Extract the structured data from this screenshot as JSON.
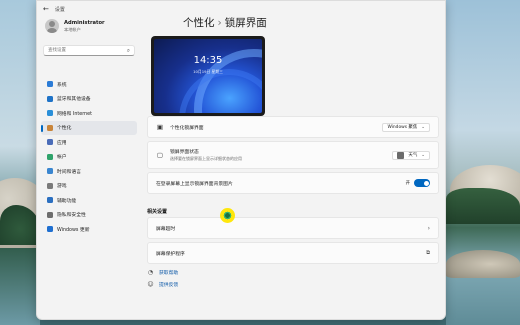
{
  "window": {
    "title": "设置",
    "back_icon": "back-arrow-icon"
  },
  "user": {
    "name": "Administrator",
    "type": "本地帐户"
  },
  "search": {
    "placeholder": "查找设置"
  },
  "nav": [
    {
      "label": "系统",
      "icon": "system-icon",
      "color": "#2b7bd6"
    },
    {
      "label": "蓝牙和其他设备",
      "icon": "bluetooth-icon",
      "color": "#1f73c7"
    },
    {
      "label": "网络和 Internet",
      "icon": "network-icon",
      "color": "#2a8fd8"
    },
    {
      "label": "个性化",
      "icon": "personalization-icon",
      "color": "#c9853a",
      "active": true
    },
    {
      "label": "应用",
      "icon": "apps-icon",
      "color": "#4a6cb8"
    },
    {
      "label": "帐户",
      "icon": "accounts-icon",
      "color": "#2fa36b"
    },
    {
      "label": "时间和语言",
      "icon": "time-language-icon",
      "color": "#3a86d0"
    },
    {
      "label": "游戏",
      "icon": "gaming-icon",
      "color": "#7a7a7a"
    },
    {
      "label": "辅助功能",
      "icon": "accessibility-icon",
      "color": "#2b6fc0"
    },
    {
      "label": "隐私和安全性",
      "icon": "privacy-icon",
      "color": "#6d6d6d"
    },
    {
      "label": "Windows 更新",
      "icon": "windows-update-icon",
      "color": "#1f6fd0"
    }
  ],
  "page": {
    "breadcrumb_parent": "个性化",
    "breadcrumb_sep": "›",
    "breadcrumb_current": "锁屏界面"
  },
  "preview": {
    "time": "14:35",
    "date": "10月19日 星期三"
  },
  "settings": {
    "personalize_label": "个性化锁屏界面",
    "personalize_value": "Windows 聚焦",
    "status_label": "锁屏界面状态",
    "status_sub": "选择要在锁屏界面上显示详细状态的应用",
    "status_value": "天气",
    "signin_bg_label": "在登录屏幕上显示锁屏界面背景图片",
    "signin_bg_state": "开",
    "signin_bg_on": true
  },
  "related": {
    "title": "相关设置",
    "timeout_label": "屏幕超时",
    "screensaver_label": "屏幕保护程序"
  },
  "links": {
    "help_label": "获取帮助",
    "feedback_label": "提供反馈"
  }
}
